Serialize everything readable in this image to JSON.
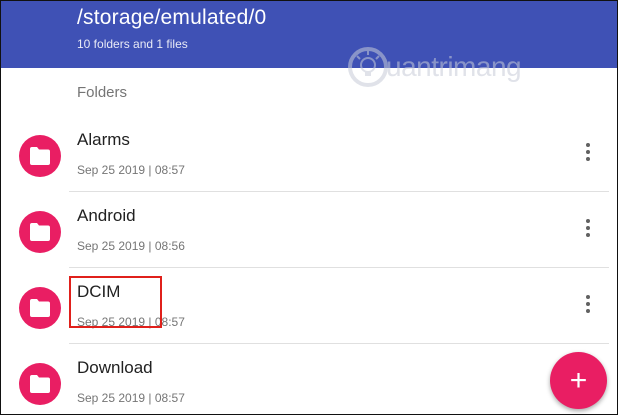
{
  "header": {
    "path": "/storage/emulated/0",
    "summary": "10 folders and 1 files",
    "color": "#3f51b5"
  },
  "watermark": {
    "text": "uantrimang",
    "icon": "lightbulb-logo-icon"
  },
  "section": {
    "title": "Folders"
  },
  "folders": [
    {
      "name": "Alarms",
      "date": "Sep 25 2019 | 08:57",
      "icon": "folder-icon",
      "menu_icon": "more-vert-icon"
    },
    {
      "name": "Android",
      "date": "Sep 25 2019 | 08:56",
      "icon": "folder-icon",
      "menu_icon": "more-vert-icon"
    },
    {
      "name": "DCIM",
      "date": "Sep 25 2019 | 08:57",
      "icon": "folder-icon",
      "menu_icon": "more-vert-icon"
    },
    {
      "name": "Download",
      "date": "Sep 25 2019 | 08:57",
      "icon": "folder-icon",
      "menu_icon": "more-vert-icon"
    }
  ],
  "fab": {
    "icon": "plus-icon",
    "glyph": "+",
    "color": "#e91e63"
  },
  "accent_color": "#e91e63",
  "highlight_color": "#e0201b"
}
